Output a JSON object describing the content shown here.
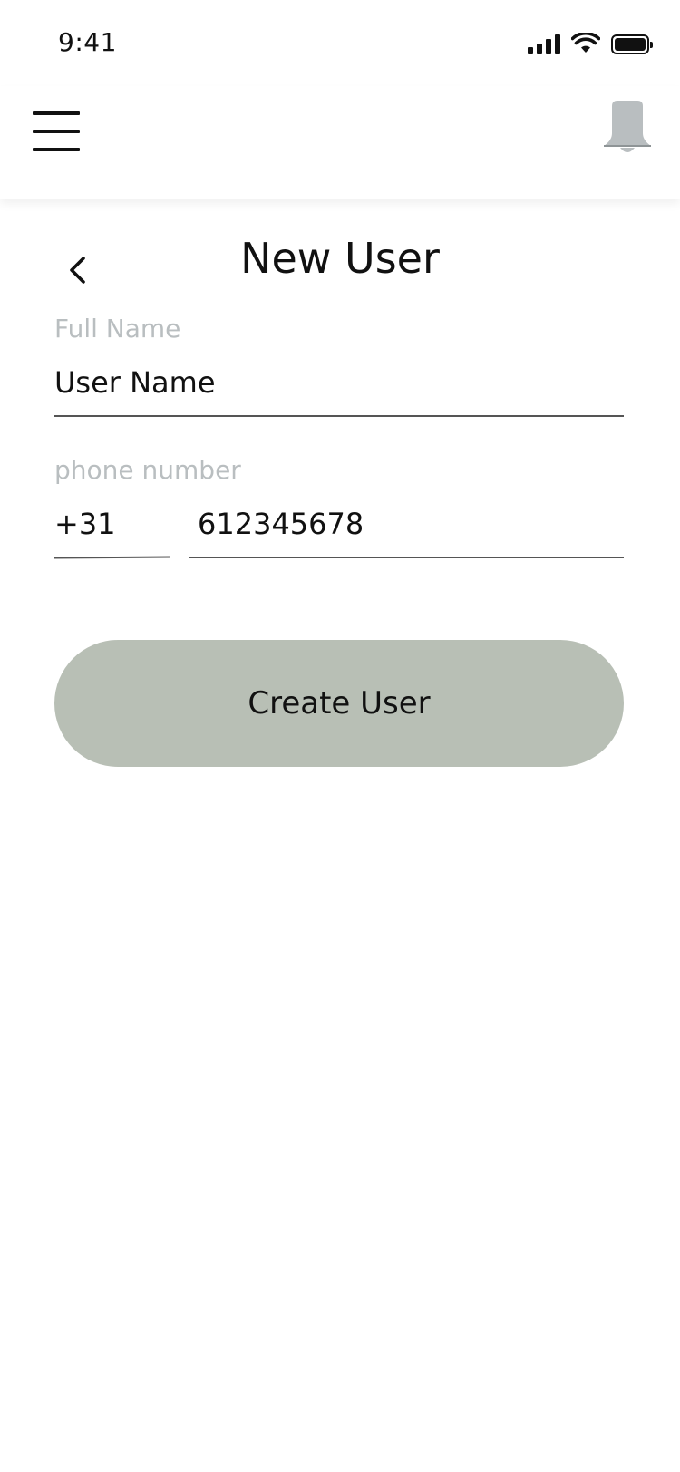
{
  "status_bar": {
    "time": "9:41",
    "icons": [
      "signal-icon",
      "wifi-icon",
      "battery-icon"
    ]
  },
  "header": {
    "menu_icon": "hamburger-menu-icon",
    "notification_icon": "bell-icon"
  },
  "page": {
    "title": "New User",
    "back_icon": "chevron-left-icon"
  },
  "form": {
    "full_name": {
      "label": "Full Name",
      "value": "User Name"
    },
    "phone": {
      "label": "phone number",
      "country_code": "+31",
      "number": "612345678"
    },
    "submit_label": "Create User"
  },
  "colors": {
    "button_bg": "#b8bfb5",
    "label_text": "#b9bec0",
    "bell": "#b9bec0"
  }
}
